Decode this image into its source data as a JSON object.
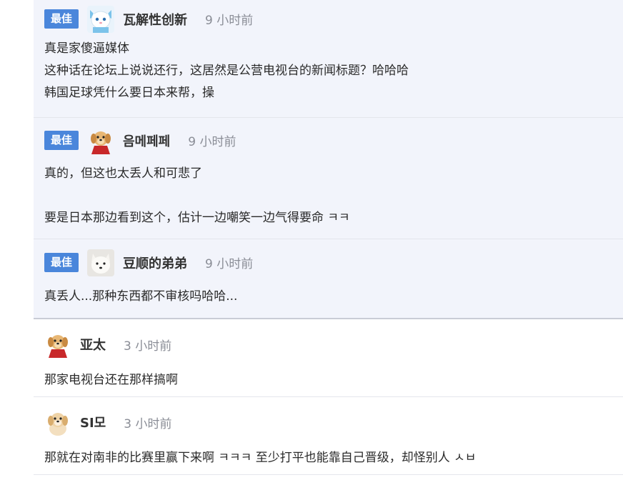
{
  "comments": [
    {
      "badge": "最佳",
      "name": "瓦解性创新",
      "time": "9 小时前",
      "avatar": "white-cat-avatar",
      "lines": [
        "真是家傻逼媒体",
        "这种话在论坛上说说还行，这居然是公营电视台的新闻标题？哈哈哈",
        "韩国足球凭什么要日本来帮，操"
      ]
    },
    {
      "badge": "最佳",
      "name": "음메페페",
      "time": "9 小时前",
      "avatar": "puppy-red-cape-avatar",
      "lines": [
        "真的，但这也太丢人和可悲了",
        "",
        "要是日本那边看到这个，估计一边嘲笑一边气得要命 ㅋㅋ"
      ]
    },
    {
      "badge": "最佳",
      "name": "豆顺的弟弟",
      "time": "9 小时前",
      "avatar": "white-dog-avatar",
      "lines": [
        "真丢人...那种东西都不审核吗哈哈..."
      ]
    },
    {
      "badge": "",
      "name": "亚太",
      "time": "3 小时前",
      "avatar": "puppy-red-cape-avatar",
      "lines": [
        "那家电视台还在那样搞啊"
      ]
    },
    {
      "badge": "",
      "name": "SI모",
      "time": "3 小时前",
      "avatar": "puppy-avatar",
      "lines": [
        "那就在对南非的比赛里赢下来啊 ㅋㅋㅋ 至少打平也能靠自己晋级，却怪别人 ㅅㅂ"
      ]
    }
  ]
}
